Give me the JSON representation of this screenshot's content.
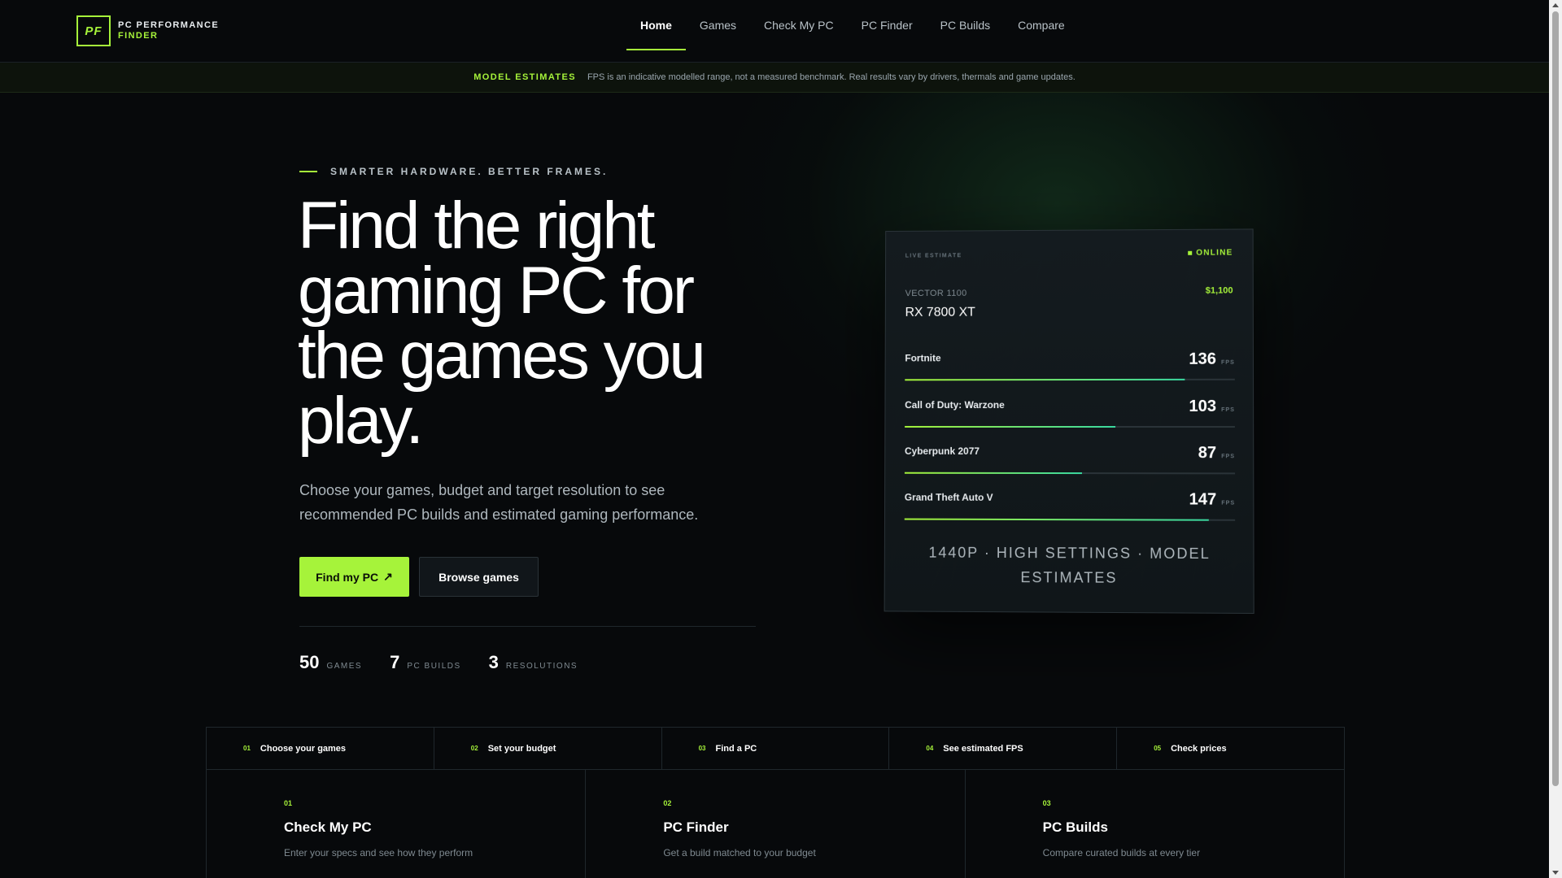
{
  "logo": {
    "mark": "PF",
    "line1": "PC PERFORMANCE",
    "line2": "FINDER"
  },
  "nav": {
    "links": [
      {
        "label": "Home",
        "active": true
      },
      {
        "label": "Games"
      },
      {
        "label": "Check My PC"
      },
      {
        "label": "PC Finder"
      },
      {
        "label": "PC Builds"
      },
      {
        "label": "Compare"
      }
    ]
  },
  "banner": {
    "tag": "MODEL ESTIMATES",
    "message": "FPS is an indicative modelled range, not a measured benchmark. Real results vary by drivers, thermals and game updates."
  },
  "hero": {
    "eyebrow": "SMARTER HARDWARE. BETTER FRAMES.",
    "title": "Find the right gaming PC for the games you play.",
    "subtitle": "Choose your games, budget and target resolution to see recommended PC builds and estimated gaming performance.",
    "primary_button": "Find my PC",
    "primary_icon": "↗",
    "secondary_button": "Browse games",
    "stats": [
      {
        "value": "50",
        "label": "GAMES"
      },
      {
        "value": "7",
        "label": "PC BUILDS"
      },
      {
        "value": "3",
        "label": "RESOLUTIONS"
      }
    ]
  },
  "card": {
    "live_label": "LIVE ESTIMATE",
    "status": "ONLINE",
    "model": "VECTOR 1100",
    "gpu": "RX 7800 XT",
    "price": "$1,100",
    "fps_unit": "FPS",
    "games": [
      {
        "name": "Fortnite",
        "fps": "136",
        "fill": 0.85
      },
      {
        "name": "Call of Duty: Warzone",
        "fps": "103",
        "fill": 0.64
      },
      {
        "name": "Cyberpunk 2077",
        "fps": "87",
        "fill": 0.54
      },
      {
        "name": "Grand Theft Auto V",
        "fps": "147",
        "fill": 0.92
      }
    ],
    "footer": "1440P · HIGH SETTINGS · MODEL ESTIMATES"
  },
  "steps": [
    {
      "num": "01",
      "label": "Choose your games"
    },
    {
      "num": "02",
      "label": "Set your budget"
    },
    {
      "num": "03",
      "label": "Find a PC"
    },
    {
      "num": "04",
      "label": "See estimated FPS"
    },
    {
      "num": "05",
      "label": "Check prices"
    }
  ],
  "features": [
    {
      "num": "01",
      "title": "Check My PC",
      "desc": "Enter your specs and see how they perform"
    },
    {
      "num": "02",
      "title": "PC Finder",
      "desc": "Get a build matched to your budget"
    },
    {
      "num": "03",
      "title": "PC Builds",
      "desc": "Compare curated builds at every tier"
    }
  ],
  "colors": {
    "accent": "#a6f33a",
    "background": "#07090b",
    "card": "#141b1f"
  }
}
